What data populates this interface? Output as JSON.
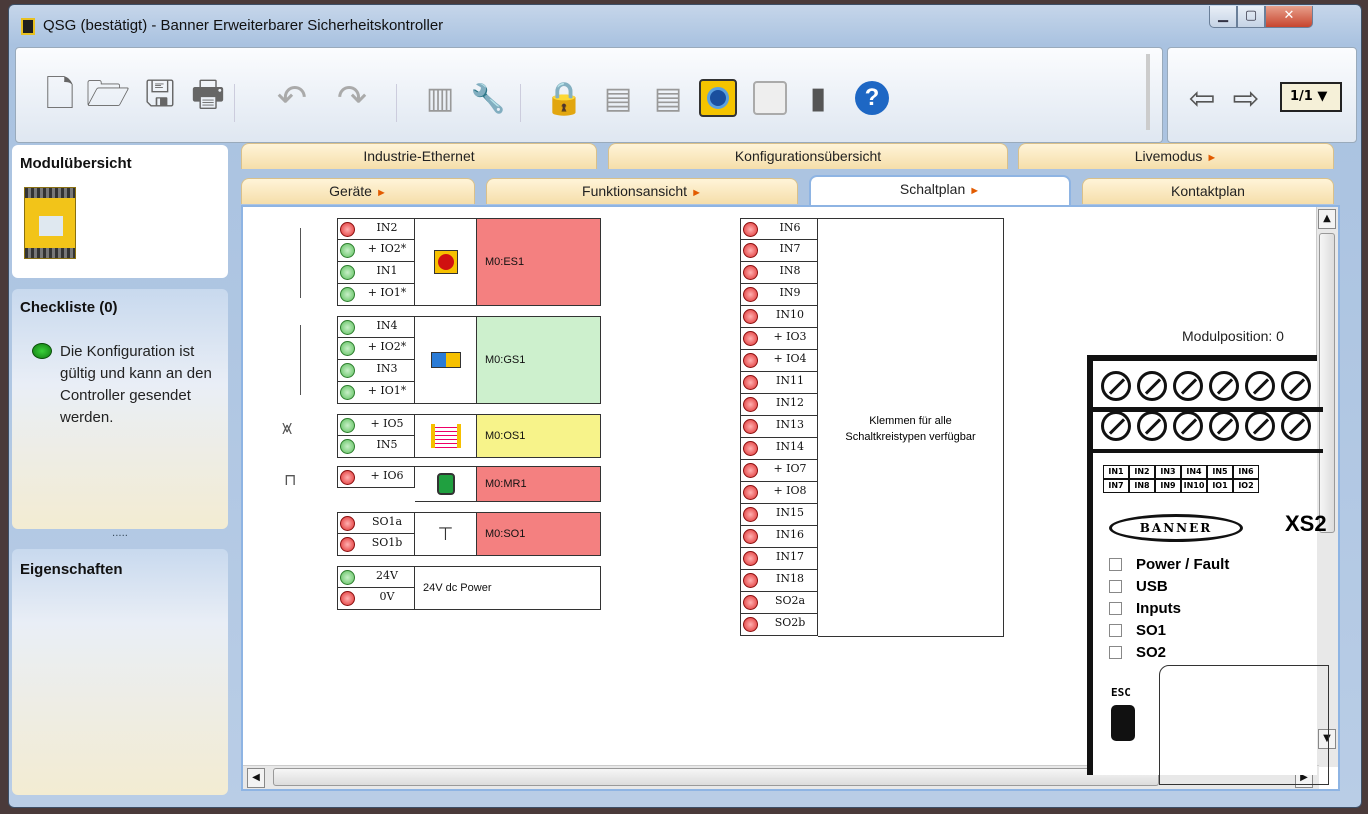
{
  "window": {
    "title": "QSG (bestätigt) - Banner Erweiterbarer Sicherheitskontroller"
  },
  "toolbar": {
    "icons": [
      "new-file-icon",
      "open-folder-icon",
      "save-icon",
      "print-icon",
      "undo-icon",
      "redo-icon",
      "controller-icon",
      "inspect-icon",
      "lock-icon",
      "upload-icon",
      "download-icon",
      "live-mode-icon",
      "settings-icon",
      "usb-icon",
      "help-icon"
    ],
    "page_selector": "1/1 ▼"
  },
  "left": {
    "module_overview_title": "Modulübersicht",
    "checklist_title": "Checkliste (0)",
    "checklist_message": "Die Konfiguration ist gültig und kann an den Controller gesendet werden.",
    "grip": "·····",
    "properties_title": "Eigenschaften"
  },
  "tabs_row1": [
    "Industrie-Ethernet",
    "Konfigurationsübersicht",
    "Livemodus"
  ],
  "tabs_row2": [
    "Geräte",
    "Funktionsansicht",
    "Schaltplan",
    "Kontaktplan"
  ],
  "devices": [
    {
      "pins": [
        "IN2",
        "+ IO2*",
        "IN1",
        "+ IO1*"
      ],
      "leds": [
        "r",
        "g",
        "g",
        "g"
      ],
      "label": "M0:ES1"
    },
    {
      "pins": [
        "IN4",
        "+ IO2*",
        "IN3",
        "+ IO1*"
      ],
      "leds": [
        "g",
        "g",
        "g",
        "g"
      ],
      "label": "M0:GS1"
    },
    {
      "pins": [
        "+ IO5",
        "IN5"
      ],
      "leds": [
        "g",
        "g"
      ],
      "label": "M0:OS1"
    },
    {
      "pins": [
        "+ IO6"
      ],
      "leds": [
        "r"
      ],
      "label": "M0:MR1"
    },
    {
      "pins": [
        "SO1a",
        "SO1b"
      ],
      "leds": [
        "r",
        "r"
      ],
      "label": "M0:SO1"
    },
    {
      "pins": [
        "24V",
        "0V"
      ],
      "leds": [
        "g",
        "r"
      ],
      "label": "24V dc Power"
    }
  ],
  "terminals": {
    "pins": [
      "IN6",
      "IN7",
      "IN8",
      "IN9",
      "IN10",
      "+ IO3",
      "+ IO4",
      "IN11",
      "IN12",
      "IN13",
      "IN14",
      "+ IO7",
      "+ IO8",
      "IN15",
      "IN16",
      "IN17",
      "IN18",
      "SO2a",
      "SO2b"
    ],
    "note": "Klemmen für alle Schaltkreistypen verfügbar"
  },
  "hardware": {
    "module_position": "Modulposition: 0",
    "pin_row1": [
      "IN1",
      "IN2",
      "IN3",
      "IN4",
      "IN5",
      "IN6"
    ],
    "pin_row2": [
      "IN7",
      "IN8",
      "IN9",
      "IN10",
      "IO1",
      "IO2"
    ],
    "brand": "BANNER",
    "model": "XS2",
    "leds": [
      "Power / Fault",
      "USB",
      "Inputs",
      "SO1",
      "SO2"
    ],
    "esc": "ESC"
  }
}
